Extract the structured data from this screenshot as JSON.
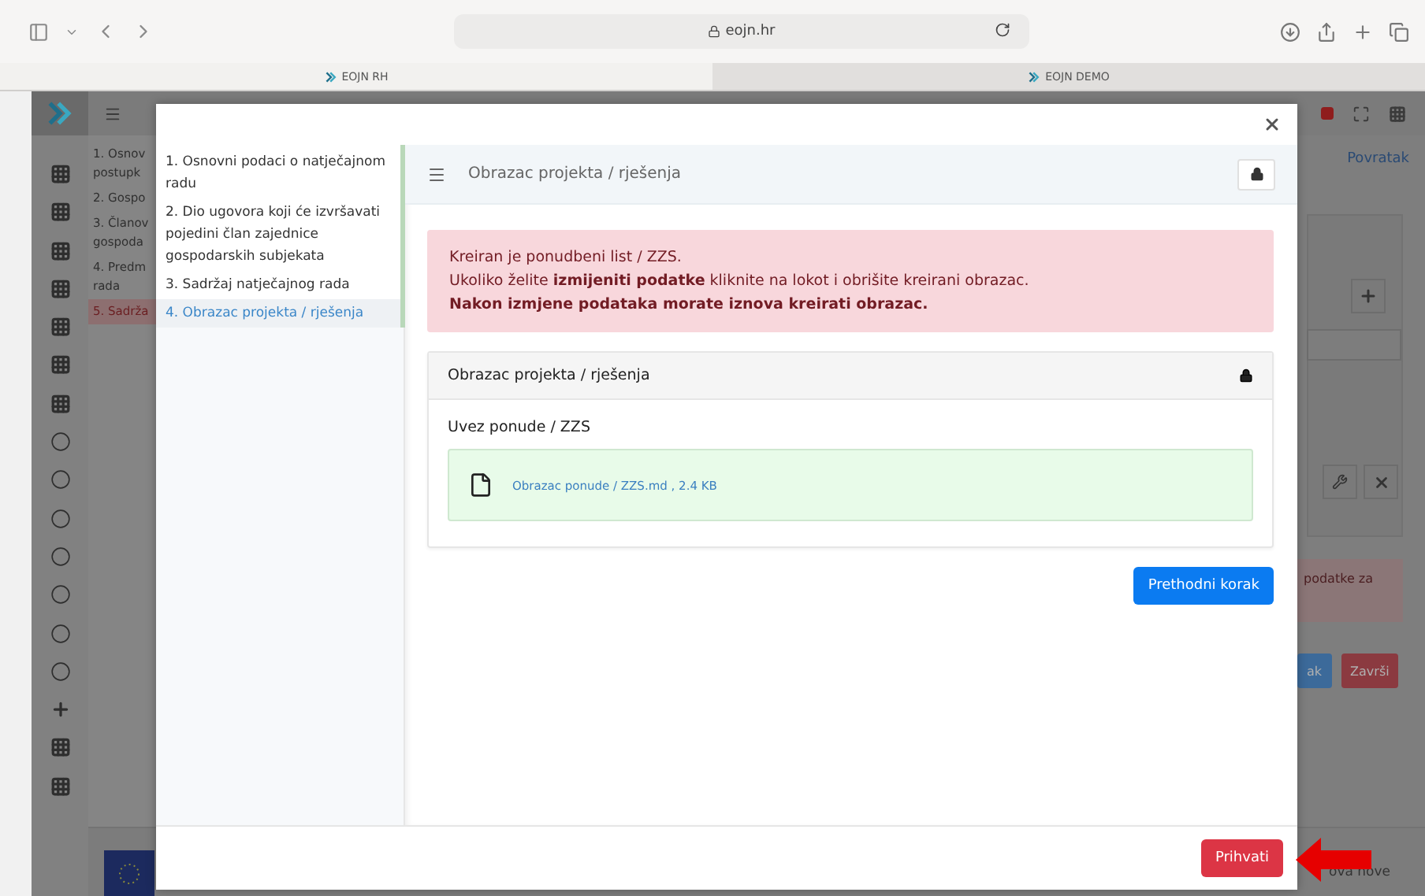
{
  "browser": {
    "address": "eojn.hr",
    "tabs": [
      {
        "label": "EOJN RH",
        "selected": true
      },
      {
        "label": "EOJN DEMO",
        "selected": false
      }
    ]
  },
  "background": {
    "rail_icons": [
      {
        "kind": "grid"
      },
      {
        "kind": "grid"
      },
      {
        "kind": "grid"
      },
      {
        "kind": "grid"
      },
      {
        "kind": "grid"
      },
      {
        "kind": "grid"
      },
      {
        "kind": "grid"
      },
      {
        "kind": "circle"
      },
      {
        "kind": "circle"
      },
      {
        "kind": "circle"
      },
      {
        "kind": "circle"
      },
      {
        "kind": "circle"
      },
      {
        "kind": "circle"
      },
      {
        "kind": "circle"
      },
      {
        "kind": "plus"
      },
      {
        "kind": "grid"
      },
      {
        "kind": "grid"
      }
    ],
    "steps": [
      {
        "lines": [
          "1. Osnov",
          "postupk"
        ],
        "selected": false
      },
      {
        "lines": [
          "2. Gospo"
        ],
        "selected": false
      },
      {
        "lines": [
          "3. Članov",
          "gospoda"
        ],
        "selected": false
      },
      {
        "lines": [
          "4. Predm",
          "rada"
        ],
        "selected": false
      },
      {
        "lines": [
          "5. Sadrža"
        ],
        "selected": true
      }
    ],
    "back_link": "Povratak",
    "alert_fragment": "podatke za",
    "buttons": [
      "ak",
      "Završi"
    ],
    "footer_fragment": "ova nove"
  },
  "modal": {
    "nav": [
      {
        "label": "1. Osnovni podaci o natječajnom radu",
        "selected": false
      },
      {
        "label": "2. Dio ugovora koji će izvršavati pojedini član zajednice gospodarskih subjekata",
        "selected": false
      },
      {
        "label": "3. Sadržaj natječajnog rada",
        "selected": false
      },
      {
        "label": "4. Obrazac projekta / rješenja",
        "selected": true
      }
    ],
    "header_title": "Obrazac projekta / rješenja",
    "alert": [
      "Kreiran je ponudbeni list / ZZS.",
      "Ukoliko želite **izmijeniti podatke** kliknite na lokot i obrišite kreirani obrazac.",
      "**Nakon izmjene podataka morate iznova kreirati obrazac.**"
    ],
    "card": {
      "title": "Obrazac projekta / rješenja",
      "field_label": "Uvez ponude / ZZS",
      "file": "Obrazac ponude / ZZS.md , 2.4 KB"
    },
    "previous_button": "Prethodni korak",
    "accept_button": "Prihvati"
  }
}
